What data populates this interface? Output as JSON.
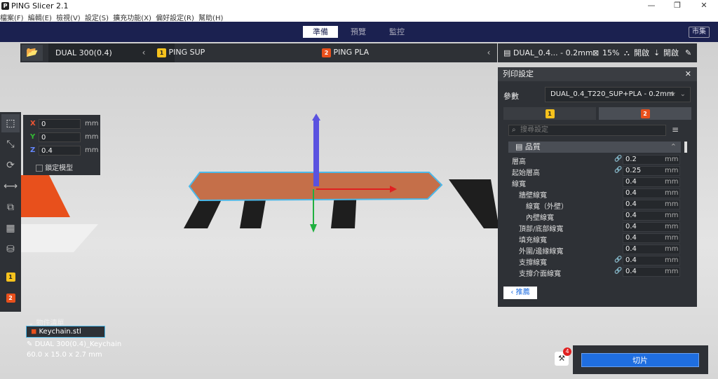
{
  "title": {
    "app": "PING Slicer 2.1",
    "logo": "P"
  },
  "window_controls": [
    "—",
    "❐",
    "✕"
  ],
  "menu": [
    "檔案(F)",
    "編輯(E)",
    "檢視(V)",
    "設定(S)",
    "擴充功能(X)",
    "偏好設定(R)",
    "幫助(H)"
  ],
  "nav": {
    "tabs": [
      "準備",
      "預覽",
      "監控"
    ],
    "active": 0,
    "shop": "市集"
  },
  "toolbar": {
    "folder_icon": "folder-icon",
    "printer": "DUAL 300(0.4)",
    "extruder1": {
      "num": "1",
      "label": "PING SUP"
    },
    "extruder2": {
      "num": "2",
      "label": "PING PLA"
    },
    "chev": "‹"
  },
  "right_toolbar": {
    "profile": "DUAL_0.4... - 0.2mm",
    "infill": "15%",
    "support": "開啟",
    "adhesion": "開啟"
  },
  "coords": {
    "x": {
      "axis": "X",
      "value": "0",
      "unit": "mm"
    },
    "y": {
      "axis": "Y",
      "value": "0",
      "unit": "mm"
    },
    "z": {
      "axis": "Z",
      "value": "0.4",
      "unit": "mm"
    },
    "lock_label": "鎖定模型"
  },
  "settings": {
    "title": "列印設定",
    "close": "✕",
    "profile_label": "參數",
    "profile_value": "DUAL_0.4_T220_SUP+PLA - 0.2mm",
    "tab1": "1",
    "tab2": "2",
    "search_placeholder": "搜尋設定",
    "category": "品質",
    "rows": [
      {
        "label": "層高",
        "value": "0.2",
        "unit": "mm",
        "link": true,
        "indent": 0
      },
      {
        "label": "起始層高",
        "value": "0.25",
        "unit": "mm",
        "link": true,
        "indent": 0
      },
      {
        "label": "線寬",
        "value": "0.4",
        "unit": "mm",
        "link": false,
        "indent": 0
      },
      {
        "label": "牆壁線寬",
        "value": "0.4",
        "unit": "mm",
        "link": false,
        "indent": 1
      },
      {
        "label": "線寬（外壁）",
        "value": "0.4",
        "unit": "mm",
        "link": false,
        "indent": 2
      },
      {
        "label": "內壁線寬",
        "value": "0.4",
        "unit": "mm",
        "link": false,
        "indent": 2
      },
      {
        "label": "頂部/底部線寬",
        "value": "0.4",
        "unit": "mm",
        "link": false,
        "indent": 1
      },
      {
        "label": "填充線寬",
        "value": "0.4",
        "unit": "mm",
        "link": false,
        "indent": 1
      },
      {
        "label": "外圍/邊緣線寬",
        "value": "0.4",
        "unit": "mm",
        "link": false,
        "indent": 1
      },
      {
        "label": "支撐線寬",
        "value": "0.4",
        "unit": "mm",
        "link": true,
        "indent": 1
      },
      {
        "label": "支撐介面線寬",
        "value": "0.4",
        "unit": "mm",
        "link": true,
        "indent": 1
      }
    ],
    "back": "推薦"
  },
  "objects": {
    "header": "物件清單",
    "item": "Keychain.stl",
    "meta": "DUAL 300(0.4)_Keychain",
    "dims": "60.0 x 15.0 x 2.7 mm"
  },
  "slice": {
    "button": "切片",
    "fix_count": "4"
  }
}
